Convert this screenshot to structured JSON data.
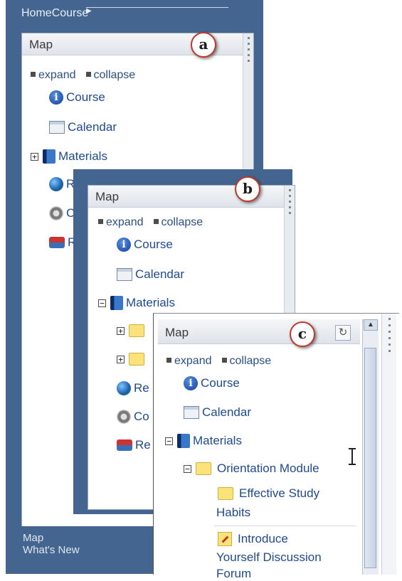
{
  "panel_a": {
    "breadcrumb": [
      "Home",
      "Course"
    ],
    "map_title": "Map",
    "expand_label": "expand",
    "collapse_label": "collapse",
    "items": [
      "Course",
      "Calendar",
      "Materials",
      "R",
      "C",
      "R"
    ],
    "bottom_links": [
      "Map",
      "What's New"
    ],
    "callout": "a"
  },
  "panel_b": {
    "map_title": "Map",
    "expand_label": "expand",
    "collapse_label": "collapse",
    "items": [
      "Course",
      "Calendar",
      "Materials",
      "Re",
      "Co",
      "Re"
    ],
    "callout": "b"
  },
  "panel_c": {
    "map_title": "Map",
    "expand_label": "expand",
    "collapse_label": "collapse",
    "course": "Course",
    "calendar": "Calendar",
    "materials": "Materials",
    "module": "Orientation Module",
    "child1_line1": "Effective Study",
    "child1_line2": "Habits",
    "child2_line1": "Introduce",
    "child2_line2": "Yourself Discussion",
    "child2_line3": "Forum",
    "callout": "c",
    "refresh_icon": "refresh-icon"
  }
}
